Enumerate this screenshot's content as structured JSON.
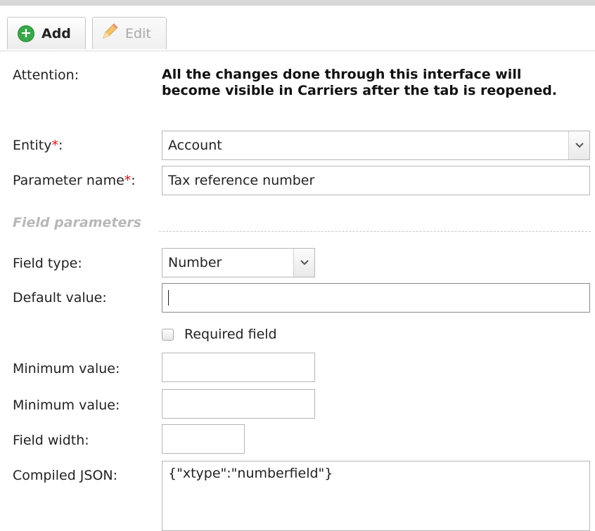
{
  "toolbar": {
    "add_label": "Add",
    "edit_label": "Edit",
    "add_icon": "plus-circle-icon",
    "edit_icon": "pencil-icon"
  },
  "form": {
    "attention_label": "Attention:",
    "attention_text": "All the changes done through this interface will become visible in Carriers after the tab is reopened.",
    "entity_label": "Entity",
    "entity_value": "Account",
    "param_label": "Parameter name",
    "param_value": "Tax reference number",
    "required_marker": "*",
    "label_colon": ":"
  },
  "field_params": {
    "section_title": "Field parameters",
    "field_type_label": "Field type:",
    "field_type_value": "Number",
    "default_value_label": "Default value:",
    "default_value": "",
    "required_label": "Required field",
    "required_checked": false,
    "min_value_label_1": "Minimum value:",
    "min_value_1": "",
    "min_value_label_2": "Minimum value:",
    "min_value_2": "",
    "field_width_label": "Field width:",
    "field_width_value": "",
    "compiled_json_label": "Compiled JSON:",
    "compiled_json_value": "{\"xtype\":\"numberfield\"}"
  },
  "colors": {
    "required": "#e01010",
    "section_title": "#b8b8b8",
    "add_icon_green": "#3aa64a"
  }
}
